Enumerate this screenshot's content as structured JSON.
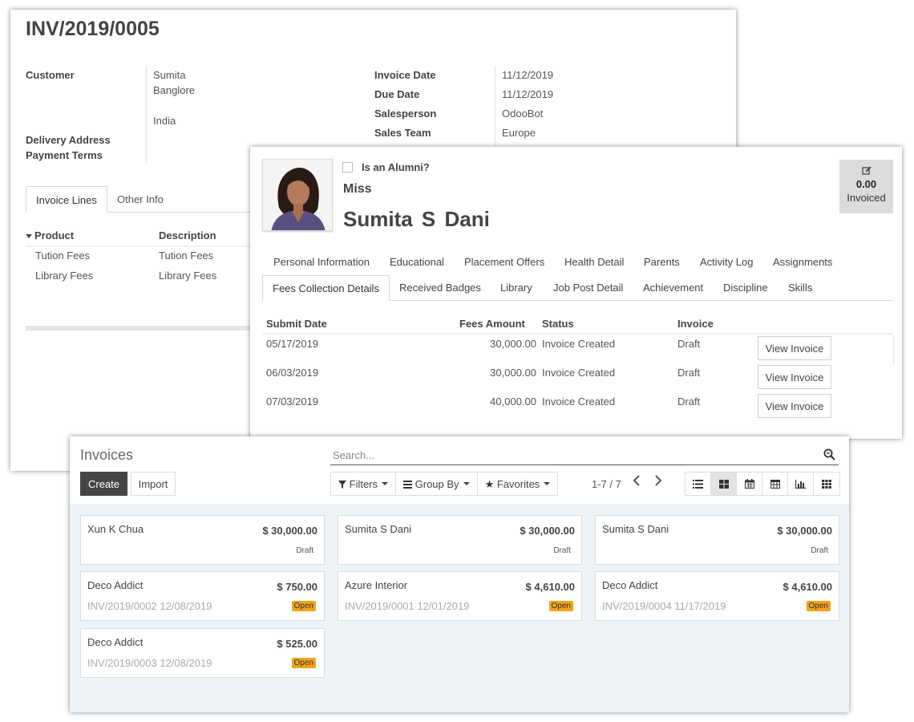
{
  "invoice": {
    "number": "INV/2019/0005",
    "left_fields": {
      "customer_label": "Customer",
      "customer_name": "Sumita",
      "customer_city": "Banglore",
      "customer_country": "India",
      "delivery_label": "Delivery Address",
      "payment_terms_label": "Payment Terms"
    },
    "right_fields": [
      {
        "label": "Invoice Date",
        "value": "11/12/2019"
      },
      {
        "label": "Due Date",
        "value": "11/12/2019"
      },
      {
        "label": "Salesperson",
        "value": "OdooBot"
      },
      {
        "label": "Sales Team",
        "value": "Europe"
      }
    ],
    "tabs": [
      "Invoice Lines",
      "Other Info"
    ],
    "table": {
      "headers": [
        "Product",
        "Description"
      ],
      "rows": [
        [
          "Tution Fees",
          "Tution Fees"
        ],
        [
          "Library Fees",
          "Library Fees"
        ]
      ]
    }
  },
  "student": {
    "alumni_label": "Is an Alumni?",
    "alumni_checked": false,
    "title": "Miss",
    "name": "Sumita  S  Dani",
    "stat_button": {
      "icon": "edit-icon",
      "value": "0.00",
      "label": "Invoiced"
    },
    "tabs_row1": [
      "Personal Information",
      "Educational",
      "Placement Offers",
      "Health Detail",
      "Parents",
      "Activity Log",
      "Assignments"
    ],
    "tabs_row2": [
      "Fees Collection Details",
      "Received Badges",
      "Library",
      "Job Post Detail",
      "Achievement",
      "Discipline",
      "Skills"
    ],
    "active_tab": "Fees Collection Details",
    "fees_table": {
      "headers": [
        "Submit Date",
        "Fees Amount",
        "Status",
        "Invoice"
      ],
      "rows": [
        {
          "date": "05/17/2019",
          "amount": "30,000.00",
          "status": "Invoice Created",
          "invoice": "Draft",
          "button": "View Invoice"
        },
        {
          "date": "06/03/2019",
          "amount": "30,000.00",
          "status": "Invoice Created",
          "invoice": "Draft",
          "button": "View Invoice"
        },
        {
          "date": "07/03/2019",
          "amount": "40,000.00",
          "status": "Invoice Created",
          "invoice": "Draft",
          "button": "View Invoice"
        }
      ]
    }
  },
  "invoices_list": {
    "title": "Invoices",
    "create_label": "Create",
    "import_label": "Import",
    "search_placeholder": "Search...",
    "filters_label": "Filters",
    "group_by_label": "Group By",
    "favorites_label": "Favorites",
    "pager": "1-7 / 7",
    "views": [
      "list-view-icon",
      "kanban-view-icon",
      "calendar-view-icon",
      "pivot-view-icon",
      "graph-view-icon",
      "grid-view-icon"
    ],
    "active_view": "kanban-view-icon",
    "cards": [
      {
        "name": "Xun K Chua",
        "amount": "$ 30,000.00",
        "ref": "",
        "status": "Draft"
      },
      {
        "name": "Sumita S Dani",
        "amount": "$ 30,000.00",
        "ref": "",
        "status": "Draft"
      },
      {
        "name": "Sumita S Dani",
        "amount": "$ 30,000.00",
        "ref": "",
        "status": "Draft"
      },
      {
        "name": "Deco Addict",
        "amount": "$ 750.00",
        "ref": "INV/2019/0002 12/08/2019",
        "status": "Open"
      },
      {
        "name": "Azure Interior",
        "amount": "$ 4,610.00",
        "ref": "INV/2019/0001 12/01/2019",
        "status": "Open"
      },
      {
        "name": "Deco Addict",
        "amount": "$ 4,610.00",
        "ref": "INV/2019/0004 11/17/2019",
        "status": "Open"
      },
      {
        "name": "Deco Addict",
        "amount": "$ 525.00",
        "ref": "INV/2019/0003 12/08/2019",
        "status": "Open"
      }
    ],
    "colors": {
      "open_badge": "#f0a31a",
      "create_button": "#454545",
      "kanban_bg": "#edf3f6"
    }
  }
}
